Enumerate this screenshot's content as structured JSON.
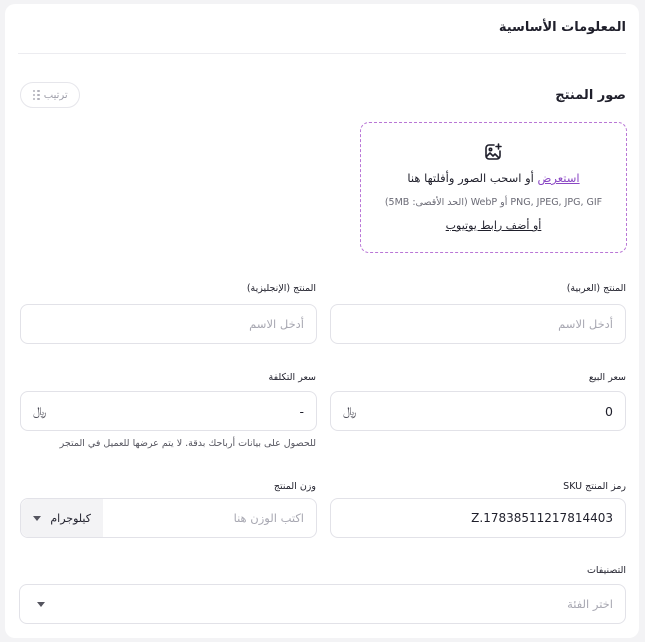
{
  "section": {
    "title": "المعلومات الأساسية"
  },
  "images": {
    "label": "صور المنتج",
    "sort_label": "ترتيب",
    "browse": "استعرض",
    "drag_text": " أو اسحب الصور وأفلتها هنا",
    "formats": "PNG, JPEG, JPG, GIF أو WebP (الحد الأقصى: 5MB)",
    "youtube": "أو أضف رابط يوتيوب"
  },
  "fields": {
    "name_ar": {
      "label": "المنتج (العربية)",
      "placeholder": "أدخل الاسم"
    },
    "name_en": {
      "label": "المنتج (الإنجليزية)",
      "placeholder": "أدخل الاسم"
    },
    "price": {
      "label": "سعر البيع",
      "value": "0",
      "currency": "﷼"
    },
    "cost": {
      "label": "سعر التكلفة",
      "value": "-",
      "currency": "﷼",
      "hint": "للحصول على بيانات أرباحك بدقة. لا يتم عرضها للعميل في المتجر"
    },
    "sku": {
      "label": "رمز المنتج SKU",
      "value": "Z.17838511217814403"
    },
    "weight": {
      "label": "وزن المنتج",
      "placeholder": "اكتب الوزن هنا",
      "unit": "كيلوجرام"
    },
    "categories": {
      "label": "التصنيفات",
      "placeholder": "اختر الفئة"
    }
  },
  "colors": {
    "accent": "#8a47c4",
    "dashed_border": "#b976d6"
  }
}
